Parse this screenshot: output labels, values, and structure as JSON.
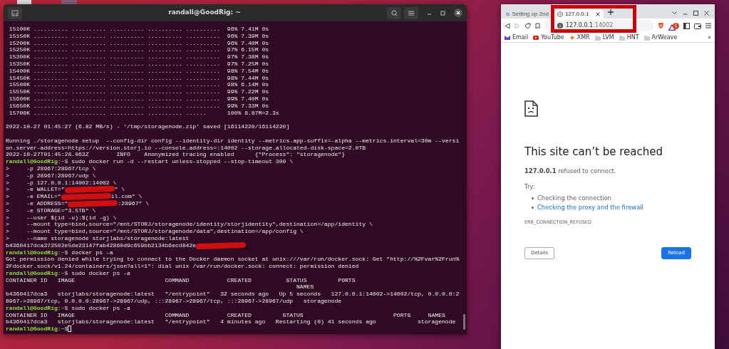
{
  "terminal": {
    "title": "randall@GoodRig: ~",
    "lines": [
      {
        "kind": "out",
        "text": " 15100K .......... .......... .......... .......... ..........  96% 7.41M 0s"
      },
      {
        "kind": "out",
        "text": " 15150K .......... .......... .......... .......... ..........  96% 7.39M 0s"
      },
      {
        "kind": "out",
        "text": " 15200K .......... .......... .......... .......... ..........  96% 7.40M 0s"
      },
      {
        "kind": "out",
        "text": " 15250K .......... .......... .......... .......... ..........  97% 6.15M 0s"
      },
      {
        "kind": "out",
        "text": " 15300K .......... .......... .......... .......... ..........  97% 7.38M 0s"
      },
      {
        "kind": "out",
        "text": " 15350K .......... .......... .......... .......... ..........  97% 7.25M 0s"
      },
      {
        "kind": "out",
        "text": " 15400K .......... .......... .......... .......... ..........  98% 7.54M 0s"
      },
      {
        "kind": "out",
        "text": " 15450K .......... .......... .......... .......... ..........  98% 7.44M 0s"
      },
      {
        "kind": "out",
        "text": " 15500K .......... .......... .......... .......... ..........  98% 6.14M 0s"
      },
      {
        "kind": "out",
        "text": " 15550K .......... .......... .......... .......... ..........  99% 7.22M 0s"
      },
      {
        "kind": "out",
        "text": " 15600K .......... .......... .......... .......... ..........  99% 7.40M 0s"
      },
      {
        "kind": "out",
        "text": " 15650K .......... .......... .......... .......... ..........  99% 7.33M 0s"
      },
      {
        "kind": "out",
        "text": " 15700K .......... .......... .......... .......... ......      100% 8.87M=2.3s"
      },
      {
        "kind": "blank"
      },
      {
        "kind": "out",
        "text": "2022-10-27 01:45:27 (6.82 MB/s) - '/tmp/storagenode.zip' saved [16114220/16114220]"
      },
      {
        "kind": "blank"
      },
      {
        "kind": "out",
        "text": "Running ./storagenode setup  --config-dir config --identity-dir identity --metrics.app-suffix=-alpha --metrics.interval=30m --versi"
      },
      {
        "kind": "out",
        "text": "on.server-address=https://version.storj.io --console.address=:14002 --storage.allocated-disk-space=2.0TB"
      },
      {
        "kind": "out",
        "text": "2022-10-27T01:45:28.063Z        INFO    Anonymized tracing enabled      {\"Process\": \"storagenode\"}"
      },
      {
        "kind": "prompt",
        "host": "randall@GoodRig",
        "dir": ":~$",
        "command": " sudo docker run -d --restart unless-stopped --stop-timeout 300 \\"
      },
      {
        "kind": "out",
        "text": ">     -p 28967:28967/tcp \\"
      },
      {
        "kind": "out",
        "text": ">     -p 28967:28967/udp \\"
      },
      {
        "kind": "out",
        "text": ">     -p 127.0.0.1:14002:14002 \\"
      },
      {
        "kind": "redacted",
        "before": ">     -e WALLET=\"",
        "after": "\" \\"
      },
      {
        "kind": "redacted",
        "before": ">     -e EMAIL=\"",
        "after": "il.com\" \\"
      },
      {
        "kind": "redacted",
        "before": ">     -e ADDRESS=\"",
        "after": ":28967\" \\"
      },
      {
        "kind": "out",
        "text": ">     -e STORAGE=\"3.5TB\" \\"
      },
      {
        "kind": "out",
        "text": ">     --user $(id -u):$(id -g) \\"
      },
      {
        "kind": "out",
        "text": ">     --mount type=bind,source=\"/mnt/STORJ/storagenode/identity/storjidentity\",destination=/app/identity \\"
      },
      {
        "kind": "out",
        "text": ">     --mount type=bind,source=\"/mnt/STORJ/storagenode/data\",destination=/app/config \\"
      },
      {
        "kind": "out",
        "text": ">     --name storagenode storjlabs/storagenode:latest"
      },
      {
        "kind": "redacted",
        "before": "b4360417dca372502e5de23147fab42860d9c659bb2134b6ecd842e"
      },
      {
        "kind": "prompt",
        "host": "randall@GoodRig",
        "dir": ":~$",
        "command": " docker ps -a"
      },
      {
        "kind": "out",
        "text": "Got permission denied while trying to connect to the Docker daemon socket at unix:///var/run/docker.sock: Get \"http://%2Fvar%2Frun%"
      },
      {
        "kind": "out",
        "text": "2Fdocker.sock/v1.24/containers/json?all=1\": dial unix /var/run/docker.sock: connect: permission denied"
      },
      {
        "kind": "prompt",
        "host": "randall@GoodRig",
        "dir": ":~$",
        "command": " sudo docker ps -a"
      },
      {
        "kind": "out",
        "text": "CONTAINER ID   IMAGE                          COMMAND           CREATED          STATUS         PORTS"
      },
      {
        "kind": "out",
        "text": "                                                                                    NAMES"
      },
      {
        "kind": "out",
        "text": "b4360417dca3   storjlabs/storagenode:latest   \"/entrypoint\"   32 seconds ago   Up 5 seconds   127.0.0.1:14002->14002/tcp, 0.0.0.0:2"
      },
      {
        "kind": "out",
        "text": "8967->28967/tcp, 0.0.0.0:28967->28967/udp, :::28967->28967/tcp, :::28967->28967/udp   storagenode"
      },
      {
        "kind": "prompt",
        "host": "randall@GoodRig",
        "dir": ":~$",
        "command": " sudo docker ps -a"
      },
      {
        "kind": "out",
        "text": "CONTAINER ID   IMAGE                          COMMAND           CREATED         STATUS                          PORTS     NAMES"
      },
      {
        "kind": "out",
        "text": "b4360417dca3   storjlabs/storagenode:latest   \"/entrypoint\"   4 minutes ago   Restarting (0) 41 seconds ago            storagenode"
      },
      {
        "kind": "prompt",
        "host": "randall@GoodRig",
        "dir": ":~$",
        "cursor": true
      }
    ]
  },
  "browser": {
    "tabs": [
      {
        "label": "Setting up 2nd",
        "selected": false
      },
      {
        "label": "127.0.0.1",
        "selected": true
      }
    ],
    "address": {
      "host": "127.0.0.1",
      "port": ":14002"
    },
    "rewards_badge": "1",
    "bookmarks": [
      {
        "label": "Email",
        "kind": "mail"
      },
      {
        "label": "YouTube",
        "kind": "video"
      },
      {
        "label": "XMR",
        "kind": "spark"
      },
      {
        "label": "LVM",
        "kind": "folder"
      },
      {
        "label": "HNT",
        "kind": "folder"
      },
      {
        "label": "ArWeave",
        "kind": "folder"
      }
    ],
    "bookmarks_more": "»",
    "error": {
      "heading": "This site can’t be reached",
      "message": "**127.0.0.1** refused to connect.",
      "try_label": "Try:",
      "suggestions": [
        {
          "text": "Checking the connection",
          "kind": "plain"
        },
        {
          "text": "Checking the proxy and the firewall",
          "kind": "link"
        }
      ],
      "code": "ERR_CONNECTION_REFUSED",
      "buttons": [
        {
          "label": "Details",
          "kind": "secondary"
        },
        {
          "label": "Reload",
          "kind": "primary"
        }
      ]
    }
  },
  "annotation": {
    "kind": "rectangle"
  }
}
